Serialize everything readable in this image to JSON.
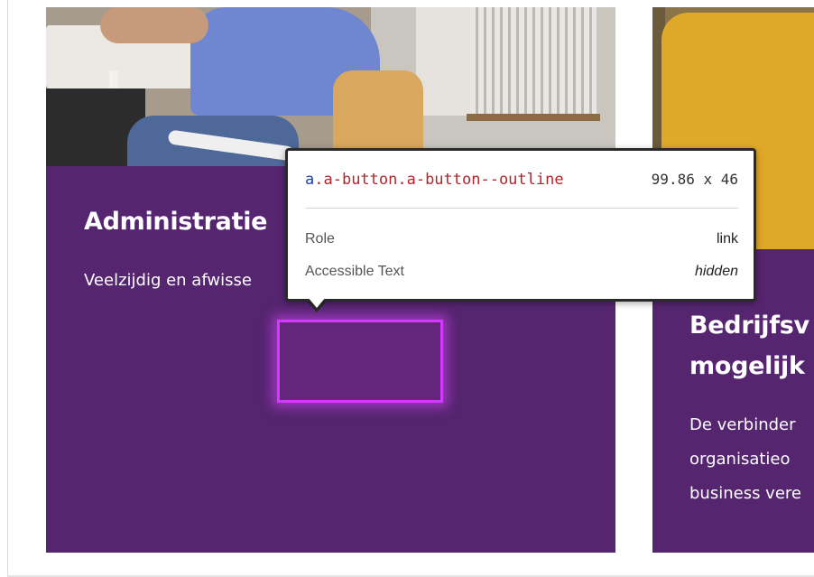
{
  "cards": [
    {
      "title": "Administratie",
      "text": "Veelzijdig en afwisse"
    },
    {
      "title_line1": "Bedrijfsv",
      "title_line2": "mogelijk",
      "text_line1": "De verbinder",
      "text_line2": "organisatieo",
      "text_line3": "business vere"
    }
  ],
  "inspector": {
    "tag": "a",
    "classes": ".a-button.a-button--outline",
    "size": "99.86 x 46",
    "rows": [
      {
        "label": "Role",
        "value": "link"
      },
      {
        "label": "Accessible Text",
        "value": "hidden"
      }
    ]
  },
  "colors": {
    "panel": "#55256f",
    "highlight": "#d339ff",
    "tag": "#1d3fb0",
    "class": "#b2262b"
  }
}
